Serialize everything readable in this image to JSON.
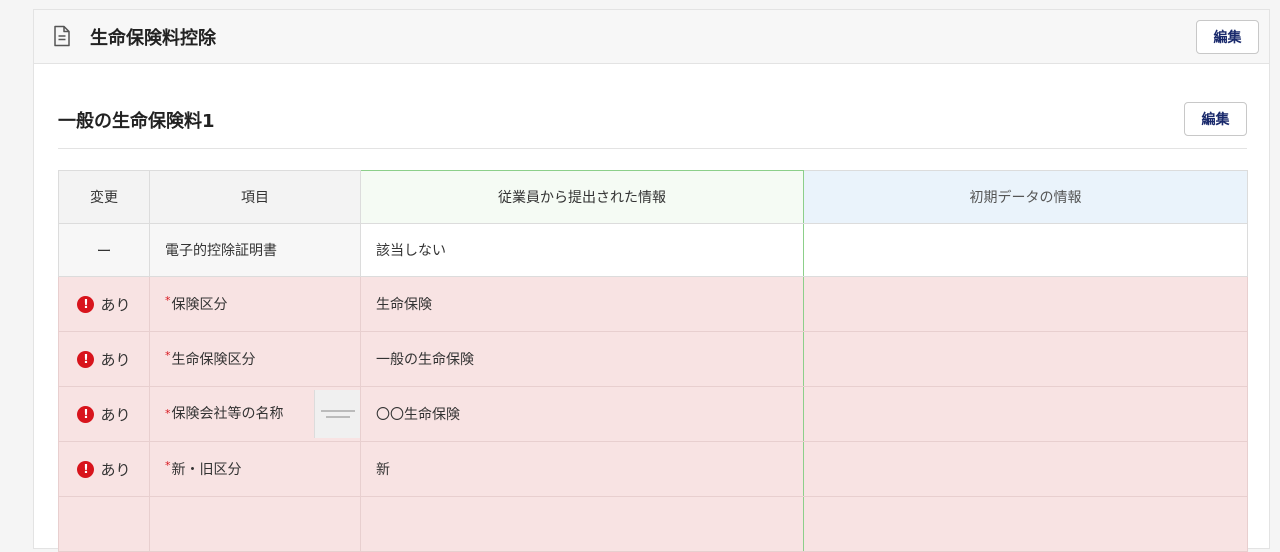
{
  "card": {
    "title": "生命保険料控除",
    "edit_label": "編集"
  },
  "section": {
    "title": "一般の生命保険料1",
    "edit_label": "編集"
  },
  "table": {
    "headers": {
      "change": "変更",
      "item": "項目",
      "employee": "従業員から提出された情報",
      "initial": "初期データの情報"
    },
    "rows": [
      {
        "change": "ー",
        "item": "電子的控除証明書",
        "employee": "該当しない",
        "initial": ""
      },
      {
        "change": "あり",
        "item": "保険区分",
        "employee": "生命保険",
        "initial": ""
      },
      {
        "change": "あり",
        "item": "生命保険区分",
        "employee": "一般の生命保険",
        "initial": ""
      },
      {
        "change": "あり",
        "item": "保険会社等の名称",
        "employee": "〇〇生命保険",
        "initial": ""
      },
      {
        "change": "あり",
        "item": "新・旧区分",
        "employee": "新",
        "initial": ""
      },
      {
        "change": "",
        "item": "",
        "employee": "",
        "initial": ""
      }
    ]
  },
  "icons": {
    "document": "document-icon",
    "alert": "alert-icon"
  },
  "colors": {
    "diff_row_bg": "#f8e3e3",
    "alert": "#d8141c",
    "employee_column_border": "#8ccf8a",
    "initial_header_bg": "#eaf3fb",
    "button_text": "#1a2a6c"
  }
}
